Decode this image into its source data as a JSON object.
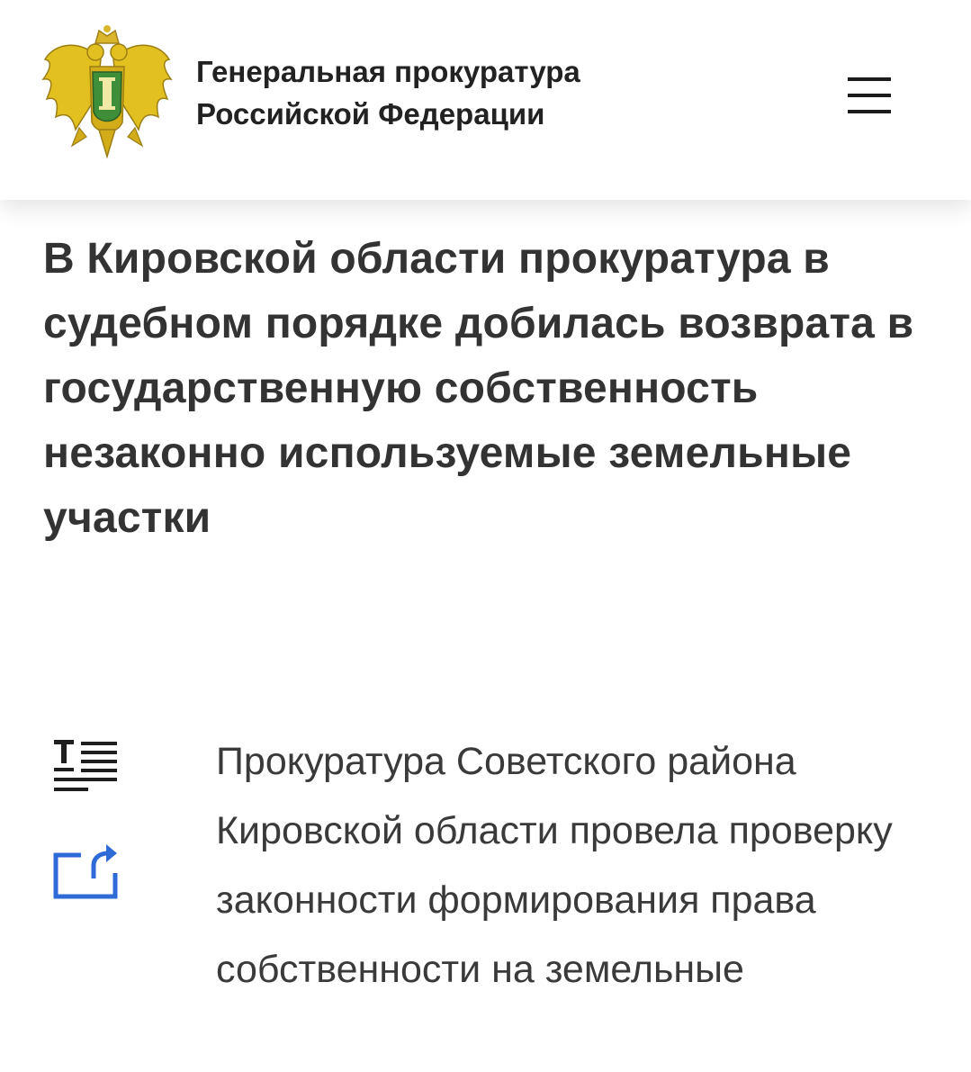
{
  "header": {
    "org_name_line1": "Генеральная прокуратура",
    "org_name_line2": "Российской Федерации",
    "logo_icon": "emblem-double-headed-eagle-icon",
    "menu_icon": "hamburger-menu-icon"
  },
  "article": {
    "title": "В Кировской области прокуратура в судебном порядке добилась возврата в государственную собственность незаконно используемые земельные участки",
    "body": "Прокуратура Советского района Кировской области провела проверку законности формирования права собственности на земельные"
  },
  "tools": {
    "text_size_icon": "text-size-icon",
    "share_icon": "share-icon"
  },
  "colors": {
    "accent_blue": "#2f6bd6",
    "emblem_gold": "#d6b400",
    "emblem_green": "#3a8a3a",
    "title_text": "#333333"
  }
}
